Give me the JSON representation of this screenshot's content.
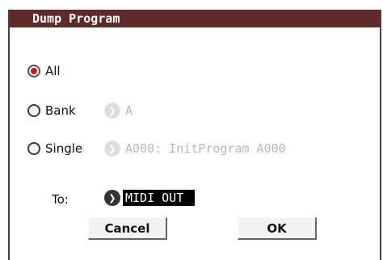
{
  "dialog": {
    "title": "Dump Program",
    "options": {
      "all": {
        "label": "All",
        "selected": true
      },
      "bank": {
        "label": "Bank",
        "value": "A",
        "enabled": false
      },
      "single": {
        "label": "Single",
        "value": "A000: InitProgram A000",
        "enabled": false
      }
    },
    "to": {
      "label": "To:",
      "value": "MIDI OUT"
    },
    "buttons": {
      "cancel": "Cancel",
      "ok": "OK"
    }
  },
  "colors": {
    "titlebar": "#5e2a2a",
    "radio_selected": "#cc1b1b"
  },
  "icons": {
    "popup": "chevron-right-icon"
  }
}
